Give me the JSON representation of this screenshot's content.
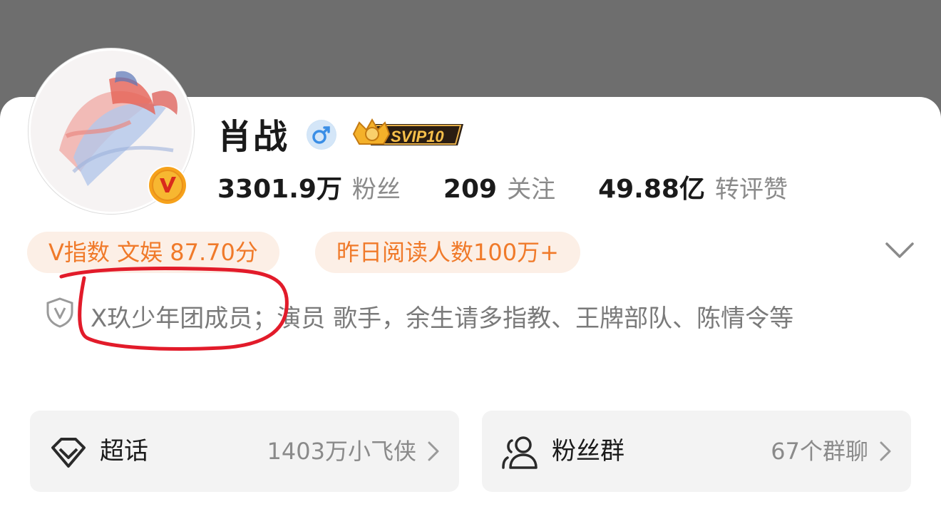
{
  "profile": {
    "name": "肖战",
    "gender_icon": "male-icon",
    "vip_badge": "SVIP10",
    "verified_icon": "v-verified-icon"
  },
  "stats": [
    {
      "value": "3301.9万",
      "label": "粉丝"
    },
    {
      "value": "209",
      "label": "关注"
    },
    {
      "value": "49.88亿",
      "label": "转评赞"
    }
  ],
  "tags": {
    "v_index": "V指数 文娱 87.70分",
    "reads": "昨日阅读人数100万+"
  },
  "bio": {
    "text": "X玖少年团成员；演员 歌手，余生请多指教、王牌部队、陈情令等"
  },
  "tiles": {
    "supertopic": {
      "label": "超话",
      "value": "1403万小飞侠"
    },
    "fangroup": {
      "label": "粉丝群",
      "value": "67个群聊"
    }
  },
  "colors": {
    "accent_orange": "#f07a2a",
    "annotation_red": "#e21b2a",
    "header_gray": "#6e6e6e"
  }
}
